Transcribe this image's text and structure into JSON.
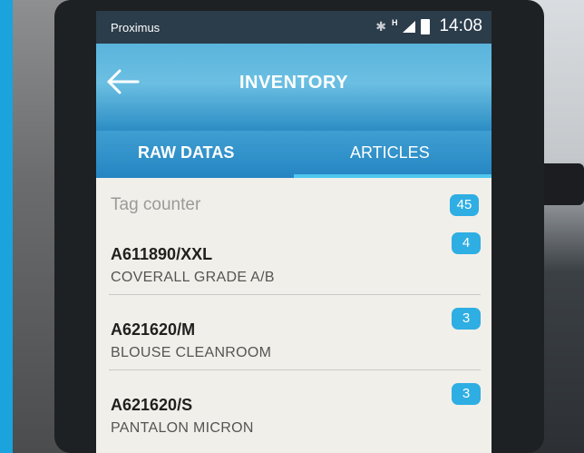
{
  "status_bar": {
    "carrier": "Proximus",
    "network_label": "H",
    "time": "14:08"
  },
  "app_bar": {
    "title": "INVENTORY",
    "back_icon": "arrow-left-icon"
  },
  "tabs": [
    {
      "label": "RAW DATAS",
      "selected": false
    },
    {
      "label": "ARTICLES",
      "selected": true
    }
  ],
  "tag_counter": {
    "label": "Tag counter",
    "count": "45"
  },
  "items": [
    {
      "code": "A611890/XXL",
      "name": "COVERALL GRADE A/B",
      "count": "4"
    },
    {
      "code": "A621620/M",
      "name": "BLOUSE CLEANROOM",
      "count": "3"
    },
    {
      "code": "A621620/S",
      "name": "PANTALON MICRON",
      "count": "3"
    }
  ],
  "colors": {
    "accent": "#2eaee3",
    "app_bar": "#5ab4dc",
    "tab_bar": "#2585c2",
    "status_bar": "#2b3c4a"
  }
}
